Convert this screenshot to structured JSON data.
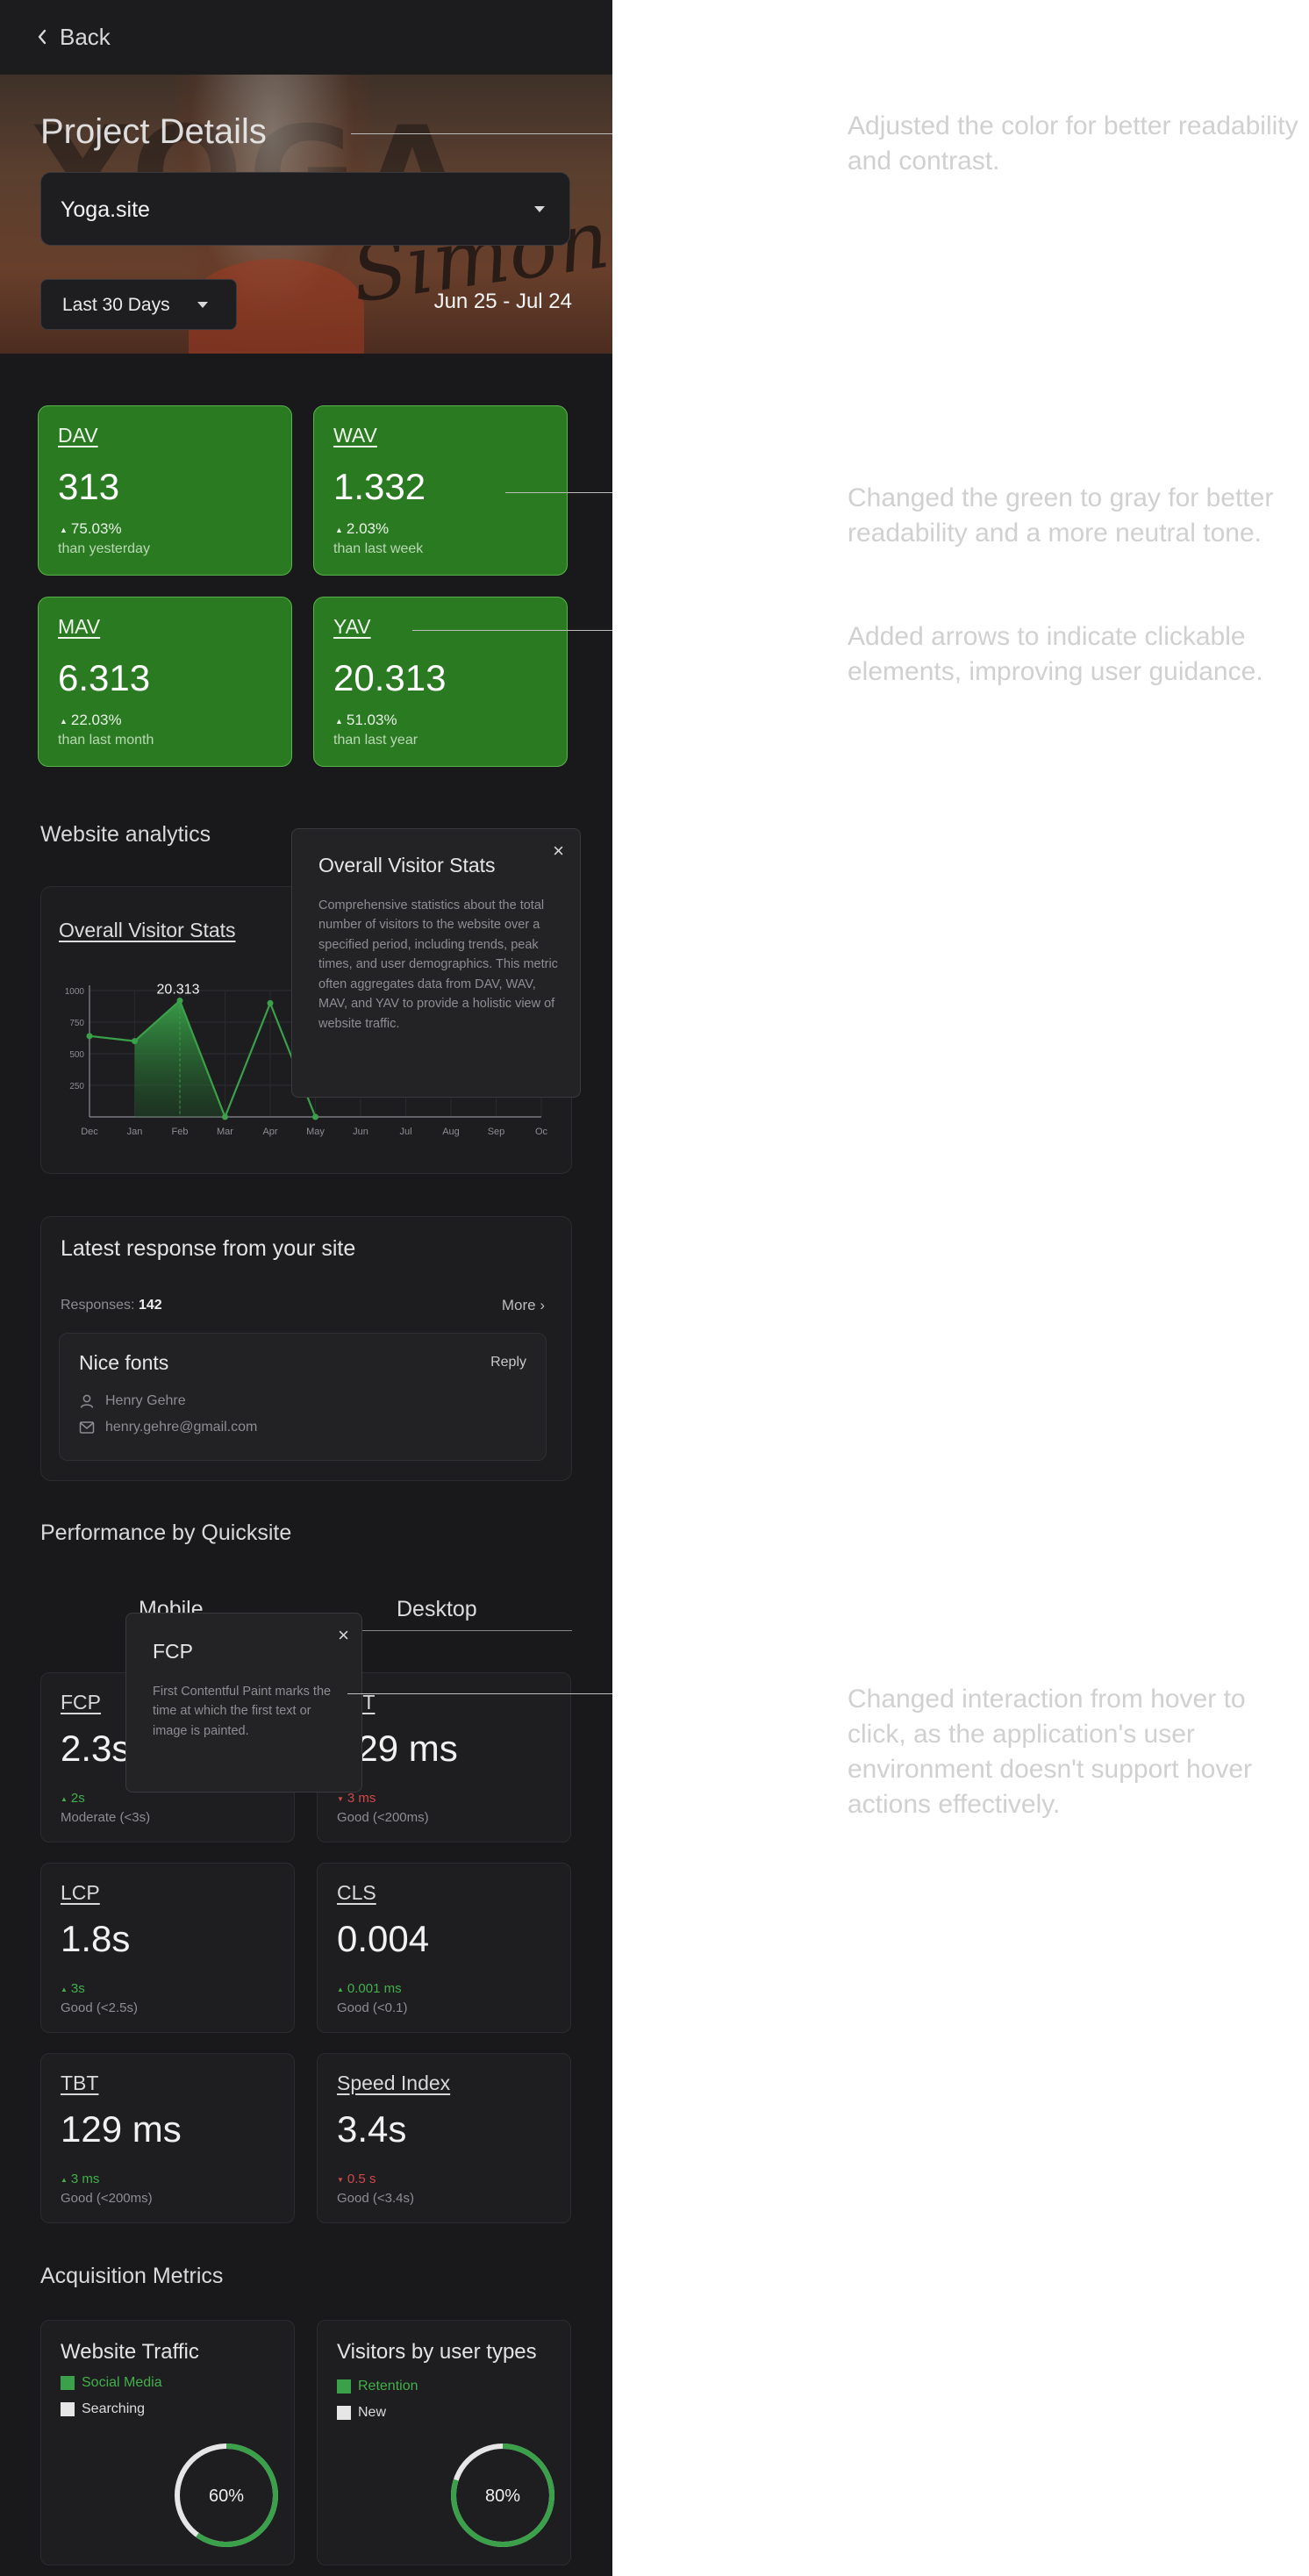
{
  "header": {
    "back_label": "Back"
  },
  "hero": {
    "brand_text": "YOGA",
    "script_text": "Simone"
  },
  "project": {
    "title": "Project Details",
    "site_value": "Yoga.site",
    "range_value": "Last 30 Days",
    "date_range": "Jun 25 - Jul 24"
  },
  "stats": [
    {
      "label": "DAV",
      "value": "313",
      "pct": "75.03%",
      "sub": "than yesterday"
    },
    {
      "label": "WAV",
      "value": "1.332",
      "pct": "2.03%",
      "sub": "than last week"
    },
    {
      "label": "MAV",
      "value": "6.313",
      "pct": "22.03%",
      "sub": "than last month"
    },
    {
      "label": "YAV",
      "value": "20.313",
      "pct": "51.03%",
      "sub": "than last year"
    }
  ],
  "analytics": {
    "section_title": "Website analytics",
    "chart_title": "Overall Visitor Stats",
    "peak_label": "20.313",
    "popover_title": "Overall Visitor Stats",
    "popover_body": "Comprehensive statistics about the total number of visitors to the website over a specified period, including trends, peak times, and user demographics. This metric often aggregates data from DAV, WAV, MAV, and YAV to provide a holistic view of website traffic.",
    "popover_close": "×"
  },
  "chart_data": {
    "type": "line",
    "title": "Overall Visitor Stats",
    "categories": [
      "Dec",
      "Jan",
      "Feb",
      "Mar",
      "Apr",
      "May",
      "Jun",
      "Jul",
      "Aug",
      "Sep",
      "Oc"
    ],
    "yticks": [
      "1000",
      "750",
      "500",
      "250"
    ],
    "ylim": [
      0,
      1000
    ],
    "series": [
      {
        "values": [
          640,
          600,
          920,
          0,
          900,
          0,
          null,
          null,
          null,
          null,
          null
        ]
      }
    ],
    "annotation": "20.313",
    "grid": true,
    "accent": "#3aa14a"
  },
  "responses": {
    "title": "Latest  response from your site",
    "count_label": "Responses:",
    "count_value": "142",
    "more_label": "More",
    "item": {
      "title": "Nice fonts",
      "reply_label": "Reply",
      "name": "Henry Gehre",
      "email": "henry.gehre@gmail.com"
    }
  },
  "performance": {
    "section_title": "Performance by Quicksite",
    "tabs": [
      "Mobile",
      "Desktop"
    ],
    "popover_title": "FCP",
    "popover_body": "First Contentful Paint marks the time at which the first text or image is painted.",
    "popover_close": "×",
    "metrics": [
      {
        "label": "FCP",
        "value": "2.3s",
        "change": "2s",
        "dir": "up",
        "good": "Moderate (<3s)"
      },
      {
        "label": "TBT",
        "value": "129 ms",
        "change": "3 ms",
        "dir": "down",
        "good": "Good (<200ms)"
      },
      {
        "label": "LCP",
        "value": "1.8s",
        "change": "3s",
        "dir": "up",
        "good": "Good (<2.5s)"
      },
      {
        "label": "CLS",
        "value": "0.004",
        "change": "0.001 ms",
        "dir": "up",
        "good": "Good (<0.1)"
      },
      {
        "label": "TBT",
        "value": "129 ms",
        "change": "3 ms",
        "dir": "up",
        "good": "Good (<200ms)"
      },
      {
        "label": "Speed Index",
        "value": "3.4s",
        "change": "0.5 s",
        "dir": "down",
        "good": "Good (<3.4s)"
      }
    ]
  },
  "acquisition": {
    "section_title": "Acquisition Metrics",
    "cards": [
      {
        "title": "Website Traffic",
        "legend": [
          "Social Media",
          "Searching"
        ],
        "percent": 60,
        "percent_label": "60%"
      },
      {
        "title": "Visitors by user types",
        "legend": [
          "Retention",
          "New"
        ],
        "percent": 80,
        "percent_label": "80%"
      }
    ]
  },
  "notes": [
    "Adjusted the color for better readability and contrast.",
    "Changed the green to gray for better readability and a more neutral tone.",
    "Added arrows to indicate clickable elements, improving user guidance.",
    "Changed interaction from hover to click, as the application's user environment doesn't support hover actions effectively."
  ],
  "colors": {
    "accent_green": "#2a7a22",
    "positive": "#42b04a",
    "negative": "#d04848",
    "background": "#19191b"
  }
}
